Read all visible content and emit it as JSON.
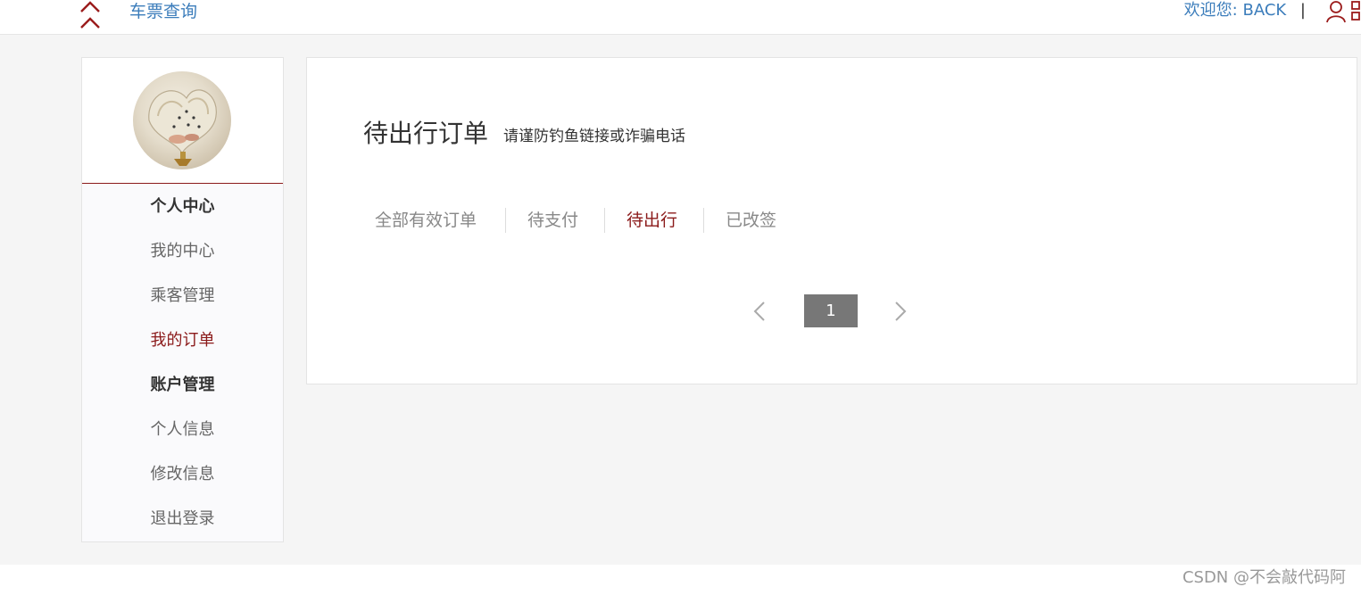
{
  "header": {
    "nav_link": "车票查询",
    "welcome": "欢迎您:",
    "username": "BACK",
    "separator": "|"
  },
  "sidebar": {
    "items": [
      {
        "label": "个人中心",
        "type": "heading"
      },
      {
        "label": "我的中心",
        "type": "link"
      },
      {
        "label": "乘客管理",
        "type": "link"
      },
      {
        "label": "我的订单",
        "type": "link",
        "active": true
      },
      {
        "label": "账户管理",
        "type": "heading"
      },
      {
        "label": "个人信息",
        "type": "link"
      },
      {
        "label": "修改信息",
        "type": "link"
      },
      {
        "label": "退出登录",
        "type": "link"
      }
    ]
  },
  "main": {
    "title": "待出行订单",
    "subtitle": "请谨防钓鱼链接或诈骗电话",
    "tabs": [
      {
        "label": "全部有效订单"
      },
      {
        "label": "待支付"
      },
      {
        "label": "待出行",
        "active": true
      },
      {
        "label": "已改签"
      }
    ],
    "pagination": {
      "current_page": "1"
    }
  },
  "watermark": "CSDN @不会敲代码阿",
  "colors": {
    "accent": "#8b1a1a",
    "link": "#3c7dbb",
    "background": "#f5f5f5",
    "pager": "#777777"
  },
  "icons": [
    "chevron-up-icon",
    "user-icon",
    "qr-icon",
    "chevron-left-icon",
    "chevron-right-icon"
  ]
}
